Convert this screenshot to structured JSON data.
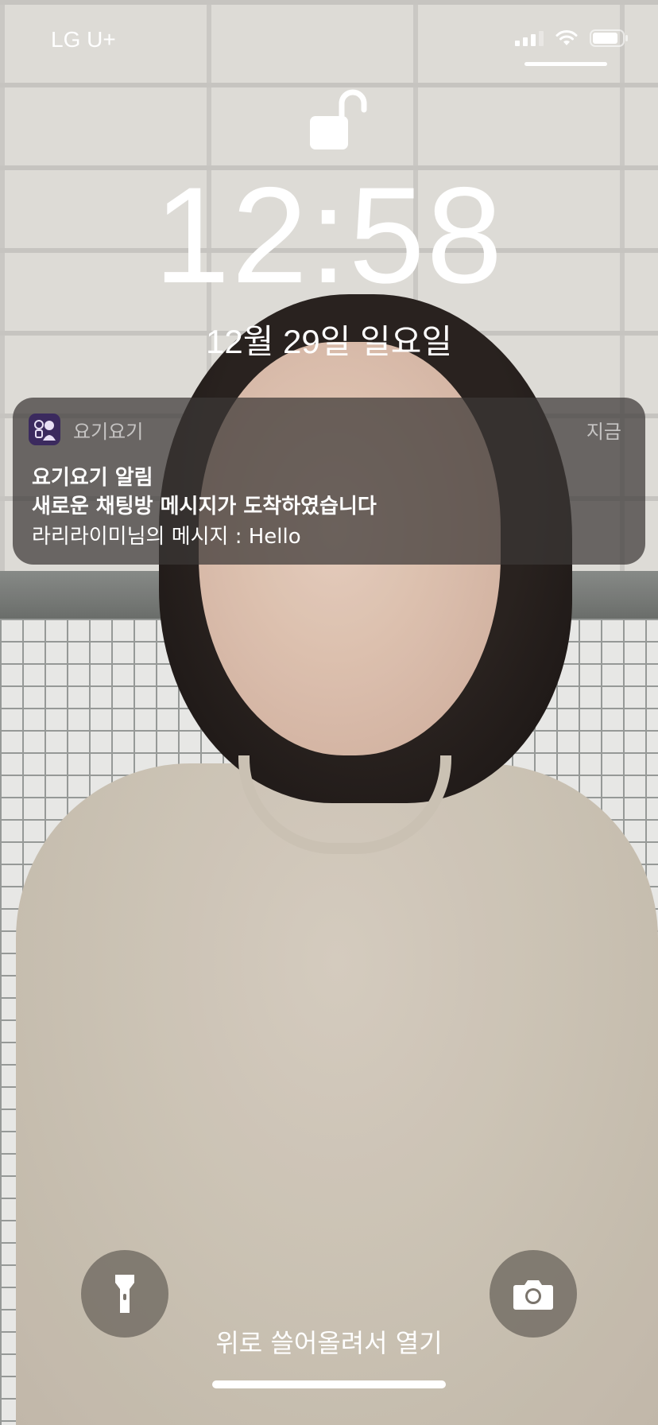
{
  "status_bar": {
    "carrier": "LG U+",
    "signal_bars": 3,
    "wifi": true,
    "battery_level": 0.85
  },
  "lock_screen": {
    "lock_state": "unlocked",
    "time": "12:58",
    "date": "12월 29일 일요일"
  },
  "notification": {
    "app_name": "요기요기",
    "time": "지금",
    "title": "요기요기 알림",
    "subtitle": "새로운 채팅방 메시지가 도착하였습니다",
    "body": "라리라이미님의 메시지 : Hello",
    "icon": "yogiyogi-app-icon"
  },
  "bottom": {
    "hint": "위로 쓸어올려서 열기",
    "left_button_icon": "flashlight-icon",
    "right_button_icon": "camera-icon"
  }
}
